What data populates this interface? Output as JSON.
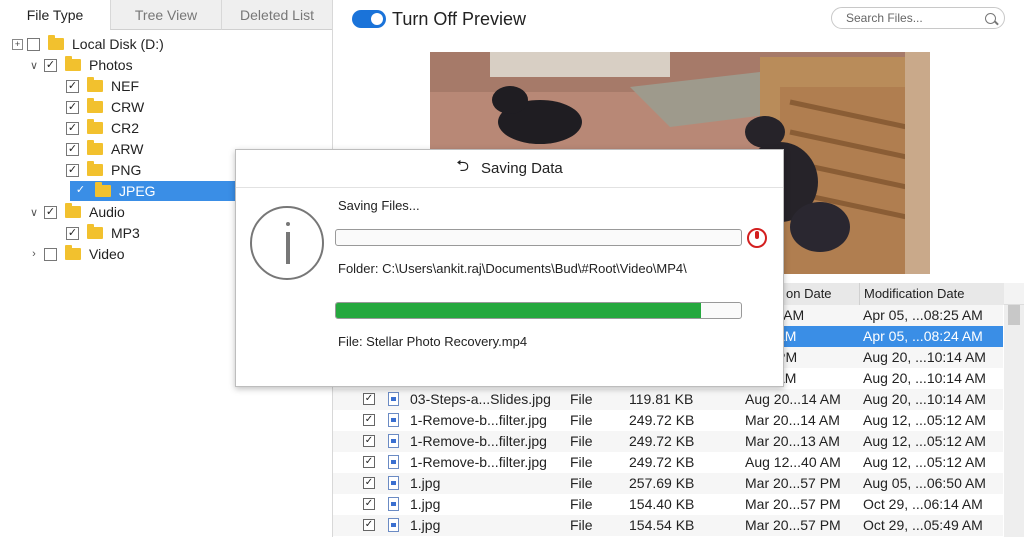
{
  "tabs": [
    "File Type",
    "Tree View",
    "Deleted List"
  ],
  "tree": [
    {
      "label": "Local Disk (D:)",
      "level": 0,
      "expander": "pm",
      "checked": false
    },
    {
      "label": "Photos",
      "level": 1,
      "expander": "open",
      "checked": true
    },
    {
      "label": "NEF",
      "level": 2,
      "checked": true
    },
    {
      "label": "CRW",
      "level": 2,
      "checked": true
    },
    {
      "label": "CR2",
      "level": 2,
      "checked": true
    },
    {
      "label": "ARW",
      "level": 2,
      "checked": true
    },
    {
      "label": "PNG",
      "level": 2,
      "checked": true
    },
    {
      "label": "JPEG",
      "level": 2,
      "checked": true,
      "selected": true
    },
    {
      "label": "Audio",
      "level": 1,
      "expander": "open",
      "checked": true
    },
    {
      "label": "MP3",
      "level": 2,
      "checked": true
    },
    {
      "label": "Video",
      "level": 1,
      "expander": "closed",
      "checked": false
    }
  ],
  "preview": {
    "toggle_label": "Turn Off Preview",
    "toggle_on": true
  },
  "search": {
    "placeholder": "Search Files..."
  },
  "table": {
    "headers": [
      "on Date",
      "Modification Date"
    ],
    "rows": [
      {
        "name": "",
        "type": "",
        "size": "",
        "created": "5...25 AM",
        "modified": "Apr 05, ...08:25 AM",
        "selected": false
      },
      {
        "name": "",
        "type": "",
        "size": "",
        "created": "...23 AM",
        "modified": "Apr 05, ...08:24 AM",
        "selected": true
      },
      {
        "name": "",
        "type": "",
        "size": "",
        "created": "...56 PM",
        "modified": "Aug 20, ...10:14 AM",
        "selected": false
      },
      {
        "name": "",
        "type": "",
        "size": "",
        "created": "...14 AM",
        "modified": "Aug 20, ...10:14 AM",
        "selected": false
      },
      {
        "name": "03-Steps-a...Slides.jpg",
        "type": "File",
        "size": "119.81 KB",
        "created": "Aug 20...14 AM",
        "modified": "Aug 20, ...10:14 AM",
        "selected": false
      },
      {
        "name": "1-Remove-b...filter.jpg",
        "type": "File",
        "size": "249.72 KB",
        "created": "Mar 20...14 AM",
        "modified": "Aug 12, ...05:12 AM",
        "selected": false
      },
      {
        "name": "1-Remove-b...filter.jpg",
        "type": "File",
        "size": "249.72 KB",
        "created": "Mar 20...13 AM",
        "modified": "Aug 12, ...05:12 AM",
        "selected": false
      },
      {
        "name": "1-Remove-b...filter.jpg",
        "type": "File",
        "size": "249.72 KB",
        "created": "Aug 12...40 AM",
        "modified": "Aug 12, ...05:12 AM",
        "selected": false
      },
      {
        "name": "1.jpg",
        "type": "File",
        "size": "257.69 KB",
        "created": "Mar 20...57 PM",
        "modified": "Aug 05, ...06:50 AM",
        "selected": false
      },
      {
        "name": "1.jpg",
        "type": "File",
        "size": "154.40 KB",
        "created": "Mar 20...57 PM",
        "modified": "Oct 29, ...06:14 AM",
        "selected": false
      },
      {
        "name": "1.jpg",
        "type": "File",
        "size": "154.54 KB",
        "created": "Mar 20...57 PM",
        "modified": "Oct 29, ...05:49 AM",
        "selected": false
      }
    ]
  },
  "dialog": {
    "title": "Saving Data",
    "saving_label": "Saving Files...",
    "folder_text": "Folder: C:\\Users\\ankit.raj\\Documents\\Bud\\#Root\\Video\\MP4\\",
    "file_text": "File: Stellar Photo Recovery.mp4",
    "progress_top": 0.0,
    "progress_bottom": 0.9
  },
  "colors": {
    "accent": "#3a8ee6",
    "progress": "#25a83e",
    "stop": "#d31f1f",
    "folder": "#f2c12e"
  },
  "icons": [
    "folder-icon",
    "checkbox-icon",
    "search-icon",
    "back-arrow-icon",
    "info-icon",
    "stop-icon",
    "file-icon"
  ]
}
